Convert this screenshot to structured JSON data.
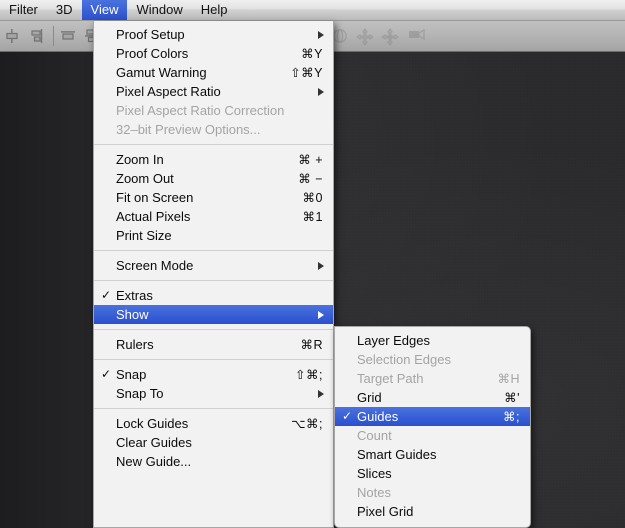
{
  "menubar": {
    "items": [
      {
        "label": "Filter",
        "active": false
      },
      {
        "label": "3D",
        "active": false
      },
      {
        "label": "View",
        "active": true
      },
      {
        "label": "Window",
        "active": false
      },
      {
        "label": "Help",
        "active": false
      }
    ]
  },
  "optionsbar": {
    "icons": [
      {
        "name": "align-vertical-centers-icon"
      },
      {
        "name": "align-right-edges-icon"
      },
      {
        "name": "distribute-top-edges-icon"
      },
      {
        "name": "distribute-vertical-centers-icon"
      },
      {
        "name": "distribute-bottom-edges-icon"
      },
      {
        "name": "auto-align-icon"
      },
      {
        "name": "rotate-3d-icon"
      },
      {
        "name": "pan-3d-icon"
      },
      {
        "name": "slide-3d-icon"
      },
      {
        "name": "camera-3d-icon"
      }
    ]
  },
  "view_menu": {
    "title": "View",
    "items": [
      {
        "label": "Proof Setup",
        "shortcut": "",
        "submenu": true,
        "checked": false,
        "disabled": false,
        "highlight": false
      },
      {
        "label": "Proof Colors",
        "shortcut": "⌘Y",
        "submenu": false,
        "checked": false,
        "disabled": false,
        "highlight": false
      },
      {
        "label": "Gamut Warning",
        "shortcut": "⇧⌘Y",
        "submenu": false,
        "checked": false,
        "disabled": false,
        "highlight": false
      },
      {
        "label": "Pixel Aspect Ratio",
        "shortcut": "",
        "submenu": true,
        "checked": false,
        "disabled": false,
        "highlight": false
      },
      {
        "label": "Pixel Aspect Ratio Correction",
        "shortcut": "",
        "submenu": false,
        "checked": false,
        "disabled": true,
        "highlight": false
      },
      {
        "label": "32–bit Preview Options...",
        "shortcut": "",
        "submenu": false,
        "checked": false,
        "disabled": true,
        "highlight": false
      },
      {
        "separator": true
      },
      {
        "label": "Zoom In",
        "shortcut": "⌘ +",
        "submenu": false,
        "checked": false,
        "disabled": false,
        "highlight": false
      },
      {
        "label": "Zoom Out",
        "shortcut": "⌘ −",
        "submenu": false,
        "checked": false,
        "disabled": false,
        "highlight": false
      },
      {
        "label": "Fit on Screen",
        "shortcut": "⌘0",
        "submenu": false,
        "checked": false,
        "disabled": false,
        "highlight": false
      },
      {
        "label": "Actual Pixels",
        "shortcut": "⌘1",
        "submenu": false,
        "checked": false,
        "disabled": false,
        "highlight": false
      },
      {
        "label": "Print Size",
        "shortcut": "",
        "submenu": false,
        "checked": false,
        "disabled": false,
        "highlight": false
      },
      {
        "separator": true
      },
      {
        "label": "Screen Mode",
        "shortcut": "",
        "submenu": true,
        "checked": false,
        "disabled": false,
        "highlight": false
      },
      {
        "separator": true
      },
      {
        "label": "Extras",
        "shortcut": "",
        "submenu": false,
        "checked": true,
        "disabled": false,
        "highlight": false
      },
      {
        "label": "Show",
        "shortcut": "",
        "submenu": true,
        "checked": false,
        "disabled": false,
        "highlight": true
      },
      {
        "separator": true
      },
      {
        "label": "Rulers",
        "shortcut": "⌘R",
        "submenu": false,
        "checked": false,
        "disabled": false,
        "highlight": false
      },
      {
        "separator": true
      },
      {
        "label": "Snap",
        "shortcut": "⇧⌘;",
        "submenu": false,
        "checked": true,
        "disabled": false,
        "highlight": false
      },
      {
        "label": "Snap To",
        "shortcut": "",
        "submenu": true,
        "checked": false,
        "disabled": false,
        "highlight": false
      },
      {
        "separator": true
      },
      {
        "label": "Lock Guides",
        "shortcut": "⌥⌘;",
        "submenu": false,
        "checked": false,
        "disabled": false,
        "highlight": false
      },
      {
        "label": "Clear Guides",
        "shortcut": "",
        "submenu": false,
        "checked": false,
        "disabled": false,
        "highlight": false
      },
      {
        "label": "New Guide...",
        "shortcut": "",
        "submenu": false,
        "checked": false,
        "disabled": false,
        "highlight": false
      }
    ]
  },
  "show_submenu": {
    "title": "Show",
    "items": [
      {
        "label": "Layer Edges",
        "shortcut": "",
        "checked": false,
        "disabled": false,
        "highlight": false
      },
      {
        "label": "Selection Edges",
        "shortcut": "",
        "checked": false,
        "disabled": true,
        "highlight": false
      },
      {
        "label": "Target Path",
        "shortcut": "⌘H",
        "checked": false,
        "disabled": true,
        "highlight": false
      },
      {
        "label": "Grid",
        "shortcut": "⌘'",
        "checked": false,
        "disabled": false,
        "highlight": false
      },
      {
        "label": "Guides",
        "shortcut": "⌘;",
        "checked": true,
        "disabled": false,
        "highlight": true
      },
      {
        "label": "Count",
        "shortcut": "",
        "checked": false,
        "disabled": true,
        "highlight": false
      },
      {
        "label": "Smart Guides",
        "shortcut": "",
        "checked": false,
        "disabled": false,
        "highlight": false
      },
      {
        "label": "Slices",
        "shortcut": "",
        "checked": false,
        "disabled": false,
        "highlight": false
      },
      {
        "label": "Notes",
        "shortcut": "",
        "checked": false,
        "disabled": true,
        "highlight": false
      },
      {
        "label": "Pixel Grid",
        "shortcut": "",
        "checked": false,
        "disabled": false,
        "highlight": false
      }
    ]
  },
  "colors": {
    "menubar_highlight": "#2b51cc",
    "menu_background": "#f2f2f2",
    "menu_highlight": "#2a4fce",
    "menu_text": "#0a0a0a",
    "menu_text_disabled": "#a4a4a4",
    "canvas_background": "#2a2a2c"
  }
}
